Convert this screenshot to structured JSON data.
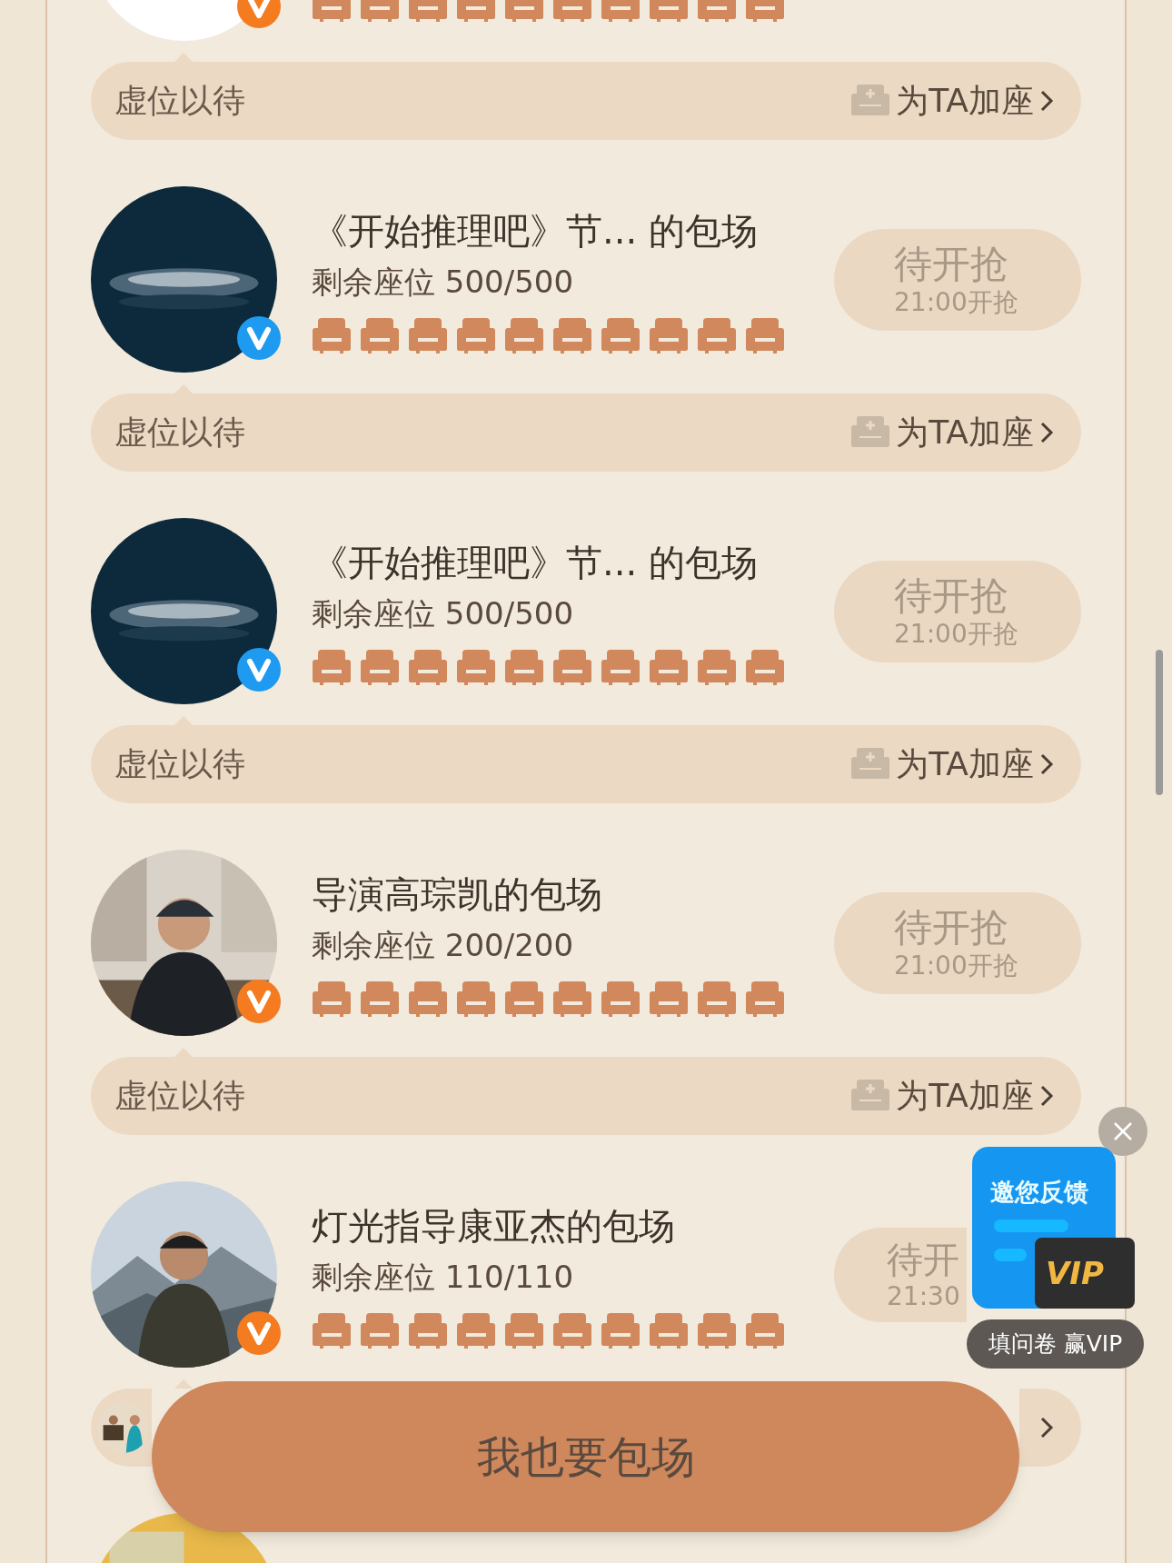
{
  "cards": [
    {
      "kind": "picture",
      "badge": {
        "color": "#f47b20"
      },
      "strip": {
        "kind": "empty",
        "label": "虚位以待",
        "action": "为TA加座"
      }
    },
    {
      "kind": "picture",
      "title": "《开始推理吧》节... 的包场",
      "seats": "剩余座位 500/500",
      "badge": {
        "color": "#1e9bf0"
      },
      "button": {
        "kind": "full",
        "label": "待开抢",
        "time": "21:00开抢"
      },
      "strip": {
        "kind": "empty",
        "label": "虚位以待",
        "action": "为TA加座"
      }
    },
    {
      "kind": "picture",
      "title": "《开始推理吧》节... 的包场",
      "seats": "剩余座位 500/500",
      "badge": {
        "color": "#1e9bf0"
      },
      "button": {
        "kind": "full",
        "label": "待开抢",
        "time": "21:00开抢"
      },
      "strip": {
        "kind": "empty",
        "label": "虚位以待",
        "action": "为TA加座"
      }
    },
    {
      "kind": "picture",
      "title": "导演高琮凯的包场",
      "seats": "剩余座位 200/200",
      "badge": {
        "color": "#f47b20"
      },
      "button": {
        "kind": "full",
        "label": "待开抢",
        "time": "21:00开抢"
      },
      "strip": {
        "kind": "empty",
        "label": "虚位以待",
        "action": "为TA加座"
      }
    },
    {
      "kind": "picture",
      "title": "灯光指导康亚杰的包场",
      "seats": "剩余座位 110/110",
      "badge": {
        "color": "#f47b20"
      },
      "button": {
        "kind": "covered",
        "label": "待开",
        "time": "21:30"
      },
      "strip": {
        "kind": "supporter"
      }
    },
    {
      "kind": "picture"
    }
  ],
  "cta": {
    "label": "我也要包场"
  },
  "feedback": {
    "title": "邀您反馈",
    "badge": "VIP",
    "caption": "填问卷 赢VIP"
  }
}
